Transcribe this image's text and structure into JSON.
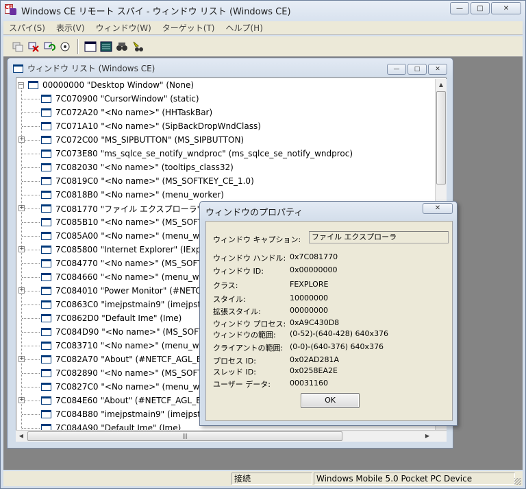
{
  "window": {
    "title": "Windows CE リモート スパイ - ウィンドウ リスト (Windows CE)",
    "minimize_label": "—",
    "maximize_label": "□",
    "close_label": "✕"
  },
  "menu": {
    "items": [
      "スパイ(S)",
      "表示(V)",
      "ウィンドウ(W)",
      "ターゲット(T)",
      "ヘルプ(H)"
    ]
  },
  "toolbar": {
    "buttons": [
      "connect-icon",
      "disconnect-icon",
      "refresh-icon",
      "settings-icon",
      "window-list-icon",
      "message-icon",
      "find-icon",
      "find-window-icon"
    ]
  },
  "child_window": {
    "title": "ウィンドウ リスト (Windows CE)"
  },
  "tree": {
    "root": "00000000 \"Desktop Window\" (None)",
    "items": [
      {
        "text": "7C070900 \"CursorWindow\" (static)",
        "expandable": false
      },
      {
        "text": "7C072A20 \"<No name>\" (HHTaskBar)",
        "expandable": false
      },
      {
        "text": "7C071A10 \"<No name>\" (SipBackDropWndClass)",
        "expandable": false
      },
      {
        "text": "7C072C00 \"MS_SIPBUTTON\" (MS_SIPBUTTON)",
        "expandable": true
      },
      {
        "text": "7C073E80 \"ms_sqlce_se_notify_wndproc\" (ms_sqlce_se_notify_wndproc)",
        "expandable": false
      },
      {
        "text": "7C082030 \"<No name>\" (tooltips_class32)",
        "expandable": false
      },
      {
        "text": "7C0819C0 \"<No name>\" (MS_SOFTKEY_CE_1.0)",
        "expandable": false
      },
      {
        "text": "7C0818B0 \"<No name>\" (menu_worker)",
        "expandable": false
      },
      {
        "text": "7C081770 \"ファイル エクスプローラ\"",
        "expandable": true
      },
      {
        "text": "7C085B10 \"<No name>\" (MS_SOFT",
        "expandable": false
      },
      {
        "text": "7C085A00 \"<No name>\" (menu_wo",
        "expandable": false
      },
      {
        "text": "7C085800 \"Internet Explorer\" (IExpl",
        "expandable": true
      },
      {
        "text": "7C084770 \"<No name>\" (MS_SOFT",
        "expandable": false
      },
      {
        "text": "7C084660 \"<No name>\" (menu_wo",
        "expandable": false
      },
      {
        "text": "7C084010 \"Power Monitor\" (#NETCF",
        "expandable": true
      },
      {
        "text": "7C0863C0 \"imejpstmain9\" (imejpstn",
        "expandable": false
      },
      {
        "text": "7C0862D0 \"Default Ime\" (Ime)",
        "expandable": false
      },
      {
        "text": "7C084D90 \"<No name>\" (MS_SOFT",
        "expandable": false
      },
      {
        "text": "7C083710 \"<No name>\" (menu_wo",
        "expandable": false
      },
      {
        "text": "7C082A70 \"About\" (#NETCF_AGL_B",
        "expandable": true
      },
      {
        "text": "7C082890 \"<No name>\" (MS_SOFT",
        "expandable": false
      },
      {
        "text": "7C0827C0 \"<No name>\" (menu_wo",
        "expandable": false
      },
      {
        "text": "7C084E60 \"About\" (#NETCF_AGL_B",
        "expandable": true
      },
      {
        "text": "7C084B80 \"imejpstmain9\" (imejpstn",
        "expandable": false
      },
      {
        "text": "7C084A90 \"Default Ime\" (Ime)",
        "expandable": false
      }
    ]
  },
  "dialog": {
    "title": "ウィンドウのプロパティ",
    "close_label": "✕",
    "caption_label": "ウィンドウ キャプション:",
    "caption_value": "ファイル エクスプローラ",
    "props": [
      {
        "label": "ウィンドウ ハンドル:",
        "value": "0x7C081770"
      },
      {
        "label": "ウィンドウ ID:",
        "value": "0x00000000"
      },
      {
        "label": "クラス:",
        "value": "FEXPLORE"
      },
      {
        "label": "スタイル:",
        "value": "10000000"
      },
      {
        "label": "拡張スタイル:",
        "value": "00000000"
      },
      {
        "label": "ウィンドウ プロセス:",
        "value": "0xA9C430D8"
      },
      {
        "label": "ウィンドウの範囲:",
        "value": "(0-52)-(640-428) 640x376"
      },
      {
        "label": "クライアントの範囲:",
        "value": "(0-0)-(640-376) 640x376"
      },
      {
        "label": "プロセス ID:",
        "value": "0x02AD281A"
      },
      {
        "label": "スレッド ID:",
        "value": "0x0258EA2E"
      },
      {
        "label": "ユーザー データ:",
        "value": "00031160"
      }
    ],
    "ok_label": "OK"
  },
  "status": {
    "connection": "接続",
    "device": "Windows Mobile 5.0 Pocket PC Device"
  }
}
